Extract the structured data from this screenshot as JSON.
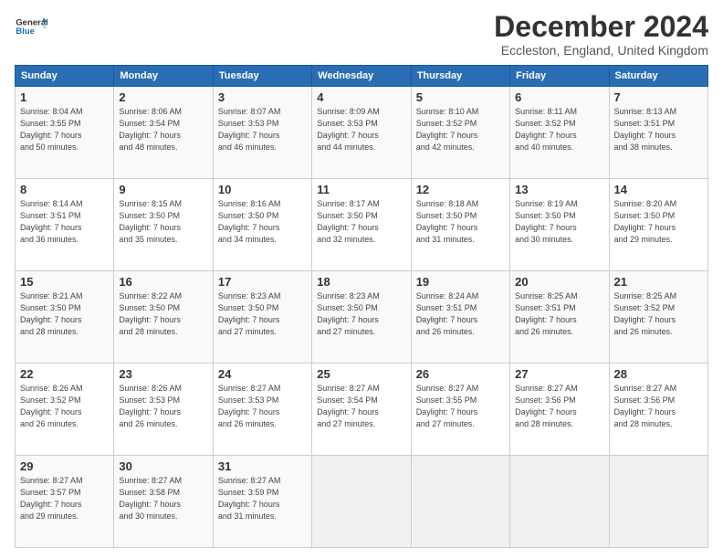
{
  "header": {
    "logo_line1": "General",
    "logo_line2": "Blue",
    "title": "December 2024",
    "subtitle": "Eccleston, England, United Kingdom"
  },
  "calendar": {
    "weekdays": [
      "Sunday",
      "Monday",
      "Tuesday",
      "Wednesday",
      "Thursday",
      "Friday",
      "Saturday"
    ],
    "weeks": [
      [
        {
          "day": "1",
          "detail": "Sunrise: 8:04 AM\nSunset: 3:55 PM\nDaylight: 7 hours\nand 50 minutes."
        },
        {
          "day": "2",
          "detail": "Sunrise: 8:06 AM\nSunset: 3:54 PM\nDaylight: 7 hours\nand 48 minutes."
        },
        {
          "day": "3",
          "detail": "Sunrise: 8:07 AM\nSunset: 3:53 PM\nDaylight: 7 hours\nand 46 minutes."
        },
        {
          "day": "4",
          "detail": "Sunrise: 8:09 AM\nSunset: 3:53 PM\nDaylight: 7 hours\nand 44 minutes."
        },
        {
          "day": "5",
          "detail": "Sunrise: 8:10 AM\nSunset: 3:52 PM\nDaylight: 7 hours\nand 42 minutes."
        },
        {
          "day": "6",
          "detail": "Sunrise: 8:11 AM\nSunset: 3:52 PM\nDaylight: 7 hours\nand 40 minutes."
        },
        {
          "day": "7",
          "detail": "Sunrise: 8:13 AM\nSunset: 3:51 PM\nDaylight: 7 hours\nand 38 minutes."
        }
      ],
      [
        {
          "day": "8",
          "detail": "Sunrise: 8:14 AM\nSunset: 3:51 PM\nDaylight: 7 hours\nand 36 minutes."
        },
        {
          "day": "9",
          "detail": "Sunrise: 8:15 AM\nSunset: 3:50 PM\nDaylight: 7 hours\nand 35 minutes."
        },
        {
          "day": "10",
          "detail": "Sunrise: 8:16 AM\nSunset: 3:50 PM\nDaylight: 7 hours\nand 34 minutes."
        },
        {
          "day": "11",
          "detail": "Sunrise: 8:17 AM\nSunset: 3:50 PM\nDaylight: 7 hours\nand 32 minutes."
        },
        {
          "day": "12",
          "detail": "Sunrise: 8:18 AM\nSunset: 3:50 PM\nDaylight: 7 hours\nand 31 minutes."
        },
        {
          "day": "13",
          "detail": "Sunrise: 8:19 AM\nSunset: 3:50 PM\nDaylight: 7 hours\nand 30 minutes."
        },
        {
          "day": "14",
          "detail": "Sunrise: 8:20 AM\nSunset: 3:50 PM\nDaylight: 7 hours\nand 29 minutes."
        }
      ],
      [
        {
          "day": "15",
          "detail": "Sunrise: 8:21 AM\nSunset: 3:50 PM\nDaylight: 7 hours\nand 28 minutes."
        },
        {
          "day": "16",
          "detail": "Sunrise: 8:22 AM\nSunset: 3:50 PM\nDaylight: 7 hours\nand 28 minutes."
        },
        {
          "day": "17",
          "detail": "Sunrise: 8:23 AM\nSunset: 3:50 PM\nDaylight: 7 hours\nand 27 minutes."
        },
        {
          "day": "18",
          "detail": "Sunrise: 8:23 AM\nSunset: 3:50 PM\nDaylight: 7 hours\nand 27 minutes."
        },
        {
          "day": "19",
          "detail": "Sunrise: 8:24 AM\nSunset: 3:51 PM\nDaylight: 7 hours\nand 26 minutes."
        },
        {
          "day": "20",
          "detail": "Sunrise: 8:25 AM\nSunset: 3:51 PM\nDaylight: 7 hours\nand 26 minutes."
        },
        {
          "day": "21",
          "detail": "Sunrise: 8:25 AM\nSunset: 3:52 PM\nDaylight: 7 hours\nand 26 minutes."
        }
      ],
      [
        {
          "day": "22",
          "detail": "Sunrise: 8:26 AM\nSunset: 3:52 PM\nDaylight: 7 hours\nand 26 minutes."
        },
        {
          "day": "23",
          "detail": "Sunrise: 8:26 AM\nSunset: 3:53 PM\nDaylight: 7 hours\nand 26 minutes."
        },
        {
          "day": "24",
          "detail": "Sunrise: 8:27 AM\nSunset: 3:53 PM\nDaylight: 7 hours\nand 26 minutes."
        },
        {
          "day": "25",
          "detail": "Sunrise: 8:27 AM\nSunset: 3:54 PM\nDaylight: 7 hours\nand 27 minutes."
        },
        {
          "day": "26",
          "detail": "Sunrise: 8:27 AM\nSunset: 3:55 PM\nDaylight: 7 hours\nand 27 minutes."
        },
        {
          "day": "27",
          "detail": "Sunrise: 8:27 AM\nSunset: 3:56 PM\nDaylight: 7 hours\nand 28 minutes."
        },
        {
          "day": "28",
          "detail": "Sunrise: 8:27 AM\nSunset: 3:56 PM\nDaylight: 7 hours\nand 28 minutes."
        }
      ],
      [
        {
          "day": "29",
          "detail": "Sunrise: 8:27 AM\nSunset: 3:57 PM\nDaylight: 7 hours\nand 29 minutes."
        },
        {
          "day": "30",
          "detail": "Sunrise: 8:27 AM\nSunset: 3:58 PM\nDaylight: 7 hours\nand 30 minutes."
        },
        {
          "day": "31",
          "detail": "Sunrise: 8:27 AM\nSunset: 3:59 PM\nDaylight: 7 hours\nand 31 minutes."
        },
        null,
        null,
        null,
        null
      ]
    ]
  }
}
